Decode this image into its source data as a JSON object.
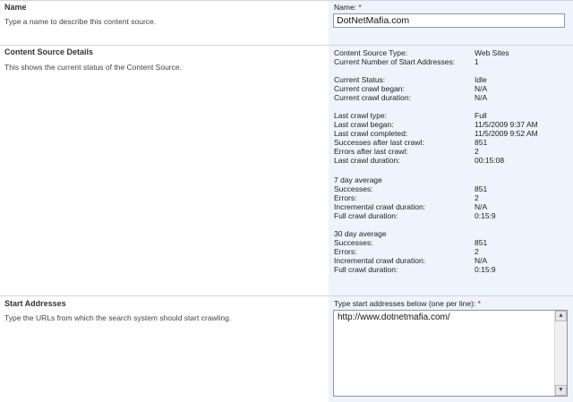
{
  "name_section": {
    "title": "Name",
    "description": "Type a name to describe this content source.",
    "field_label": "Name:",
    "required_mark": "*",
    "field_value": "DotNetMafia.com"
  },
  "details_section": {
    "title": "Content Source Details",
    "description": "This shows the current status of the Content Source.",
    "groups": [
      [
        {
          "label": "Content Source Type:",
          "value": "Web Sites"
        },
        {
          "label": "Current Number of Start Addresses:",
          "value": "1"
        }
      ],
      [
        {
          "label": "Current Status:",
          "value": "Idle"
        },
        {
          "label": "Current crawl began:",
          "value": "N/A"
        },
        {
          "label": "Current crawl duration:",
          "value": "N/A"
        }
      ],
      [
        {
          "label": "Last crawl type:",
          "value": "Full"
        },
        {
          "label": "Last crawl began:",
          "value": "11/5/2009 9:37 AM"
        },
        {
          "label": "Last crawl completed:",
          "value": "11/5/2009 9:52 AM"
        },
        {
          "label": "Successes after last crawl:",
          "value": "851"
        },
        {
          "label": "Errors after last crawl:",
          "value": "2"
        },
        {
          "label": "Last crawl duration:",
          "value": "00:15:08"
        }
      ],
      [
        {
          "label": "7 day average",
          "value": ""
        },
        {
          "label": "Successes:",
          "value": "851"
        },
        {
          "label": "Errors:",
          "value": "2"
        },
        {
          "label": "Incremental crawl duration:",
          "value": "N/A"
        },
        {
          "label": "Full crawl duration:",
          "value": "0:15:9"
        }
      ],
      [
        {
          "label": "30 day average",
          "value": ""
        },
        {
          "label": "Successes:",
          "value": "851"
        },
        {
          "label": "Errors:",
          "value": "2"
        },
        {
          "label": "Incremental crawl duration:",
          "value": "N/A"
        },
        {
          "label": "Full crawl duration:",
          "value": "0:15:9"
        }
      ]
    ]
  },
  "start_section": {
    "title": "Start Addresses",
    "description": "Type the URLs from which the search system should start crawling.",
    "field_label": "Type start addresses below (one per line):",
    "required_mark": "*",
    "field_value": "http://www.dotnetmafia.com/"
  },
  "icons": {
    "scroll_up": "▲",
    "scroll_down": "▼"
  }
}
